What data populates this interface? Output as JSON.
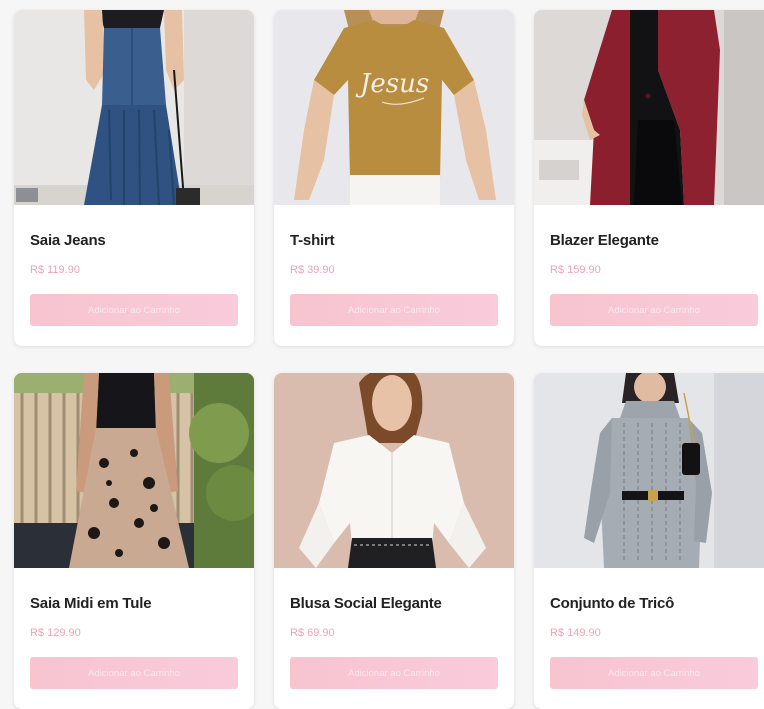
{
  "products": [
    {
      "name": "Saia Jeans",
      "price": "R$ 119.90",
      "button_label": "Adicionar ao Carrinho",
      "image_desc": "denim-skirt-photo"
    },
    {
      "name": "T-shirt",
      "price": "R$ 39.90",
      "button_label": "Adicionar ao Carrinho",
      "image_desc": "mustard-tshirt-photo",
      "print_text": "Jesus"
    },
    {
      "name": "Blazer Elegante",
      "price": "R$ 159.90",
      "button_label": "Adicionar ao Carrinho",
      "image_desc": "burgundy-blazer-photo"
    },
    {
      "name": "Saia Midi em Tule",
      "price": "R$ 129.90",
      "button_label": "Adicionar ao Carrinho",
      "image_desc": "tulle-skirt-photo"
    },
    {
      "name": "Blusa Social Elegante",
      "price": "R$ 69.90",
      "button_label": "Adicionar ao Carrinho",
      "image_desc": "white-blouse-photo"
    },
    {
      "name": "Conjunto de Tricô",
      "price": "R$ 149.90",
      "button_label": "Adicionar ao Carrinho",
      "image_desc": "knit-set-photo"
    }
  ],
  "colors": {
    "price": "#f0a3b6",
    "button": "#f7c4d0",
    "card_bg": "#ffffff",
    "page_bg": "#f6f6f7"
  }
}
